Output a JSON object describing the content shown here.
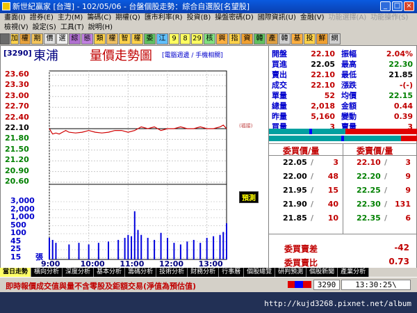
{
  "window": {
    "title": "新世紀贏家 [台灣] - 102/05/06 - 台盤個股走勢：綜合自選股[名望股]"
  },
  "menu": {
    "row1": [
      "畫面(I)",
      "證券(E)",
      "主力(M)",
      "籌碼(C)",
      "期權(Q)",
      "匯市利率(R)",
      "投資(B)",
      "操盤密碼(D)",
      "國際資訊(U)",
      "金融(V)",
      "功能選擇(A)",
      "功能操作(S)"
    ],
    "row2": [
      "檢視(V)",
      "設定(S)",
      "工具(T)",
      "說明(H)"
    ]
  },
  "toolbar": {
    "items": [
      "加",
      "權",
      "期",
      "價",
      "選",
      "綜",
      "態",
      "類",
      "權",
      "智",
      "權",
      "委",
      "江",
      "9",
      "8",
      "29",
      "核",
      "興",
      "指",
      "資",
      "韓",
      "產",
      "韓",
      "基",
      "投",
      "鮮",
      "網"
    ]
  },
  "stock": {
    "code": "[3290]",
    "name": "東浦",
    "chart_title": "量價走勢圖",
    "subtitle": "[電腦週邊 / 手機相關]"
  },
  "chart": {
    "forecast_label": "預測",
    "vol_unit": "張",
    "ref_label": "(福接)"
  },
  "quote": {
    "rows": [
      {
        "l1": "開盤",
        "v1": "22.10",
        "c1": "#c00000",
        "l2": "振幅",
        "v2": "2.04%",
        "c2": "#c00000"
      },
      {
        "l1": "買進",
        "v1": "22.05",
        "c1": "#000000",
        "l2": "最高",
        "v2": "22.30",
        "c2": "#008000"
      },
      {
        "l1": "賣出",
        "v1": "22.10",
        "c1": "#c00000",
        "l2": "最低",
        "v2": "21.85",
        "c2": "#000000"
      },
      {
        "l1": "成交",
        "v1": "22.10",
        "c1": "#c00000",
        "l2": "漲跌",
        "v2": "-(-)",
        "c2": "#c00000"
      },
      {
        "l1": "單量",
        "v1": "52",
        "c1": "#c00000",
        "l2": "均價",
        "v2": "22.15",
        "c2": "#008000"
      },
      {
        "l1": "總量",
        "v1": "2,018",
        "c1": "#c00000",
        "l2": "金額",
        "v2": "0.44",
        "c2": "#c00000"
      },
      {
        "l1": "昨量",
        "v1": "5,160",
        "c1": "#c00000",
        "l2": "變動",
        "v2": "0.39",
        "c2": "#c00000"
      },
      {
        "l1": "買量",
        "v1": "3",
        "c1": "#c00000",
        "l2": "賣量",
        "v2": "3",
        "c2": "#c00000"
      }
    ]
  },
  "orderbook": {
    "bid_header": "委買價/量",
    "ask_header": "委賣價/量",
    "bids": [
      {
        "price": "22.05",
        "vol": "3"
      },
      {
        "price": "22.00",
        "vol": "48"
      },
      {
        "price": "21.95",
        "vol": "15"
      },
      {
        "price": "21.90",
        "vol": "40"
      },
      {
        "price": "21.85",
        "vol": "10"
      }
    ],
    "asks": [
      {
        "price": "22.10",
        "vol": "3"
      },
      {
        "price": "22.20",
        "vol": "9"
      },
      {
        "price": "22.25",
        "vol": "9"
      },
      {
        "price": "22.30",
        "vol": "131"
      },
      {
        "price": "22.35",
        "vol": "6"
      }
    ]
  },
  "summary": {
    "diff_label": "委買賣差",
    "diff_value": "-42",
    "ratio_label": "委買賣比",
    "ratio_value": "0.73"
  },
  "tabs": [
    "當日走勢",
    "橫向分析",
    "深度分析",
    "基本分析",
    "籌碼分析",
    "技術分析",
    "財務分析",
    "行事曆",
    "個股總覽",
    "研判預測",
    "個股新聞",
    "產業分析"
  ],
  "status": {
    "message": "即時報價成交值與量不含零股及鉅額交易(淨值為預估值)",
    "code": "3290",
    "time": "13:30:25\\"
  },
  "watermark": "http://kujd3268.pixnet.net/album",
  "colors": {
    "up": "#c00000",
    "down": "#008000",
    "ref": "#000000",
    "price_line": "#d00000"
  },
  "chart_data": {
    "type": "line",
    "price_axis": {
      "ticks": [
        "23.60",
        "23.30",
        "23.00",
        "22.70",
        "22.40",
        "22.10",
        "21.80",
        "21.50",
        "21.20",
        "20.90",
        "20.60"
      ],
      "range": [
        20.6,
        23.6
      ],
      "reference": 22.1
    },
    "volume_axis": {
      "ticks": [
        "3,000",
        "2,000",
        "1,000",
        "500",
        "100",
        "45",
        "25",
        "15"
      ]
    },
    "x_ticks": [
      "9:00",
      "10:00",
      "11:00",
      "12:00",
      "13:00"
    ],
    "price_series": {
      "x": [
        "9:00",
        "9:05",
        "9:10",
        "9:15",
        "9:20",
        "9:25",
        "9:30",
        "9:40",
        "9:50",
        "10:00",
        "10:10",
        "10:20",
        "10:30",
        "10:40",
        "10:50",
        "11:00",
        "11:10",
        "11:20",
        "11:30",
        "11:40",
        "11:50",
        "12:00",
        "12:10",
        "12:20",
        "12:30",
        "12:40",
        "12:50",
        "13:00",
        "13:10",
        "13:20",
        "13:25",
        "13:30"
      ],
      "y": [
        22.1,
        21.95,
        21.98,
        21.95,
        22.0,
        22.05,
        22.0,
        21.98,
        22.0,
        22.05,
        22.0,
        21.98,
        22.0,
        22.05,
        22.05,
        22.0,
        22.05,
        22.15,
        22.1,
        22.15,
        22.05,
        22.1,
        22.1,
        22.15,
        22.1,
        22.1,
        22.15,
        22.1,
        22.1,
        22.15,
        22.2,
        22.1
      ]
    },
    "volume_series": {
      "x": [
        "9:00",
        "9:05",
        "9:10",
        "9:30",
        "9:45",
        "10:00",
        "10:15",
        "10:30",
        "10:45",
        "10:55",
        "11:00",
        "11:05",
        "11:10",
        "11:15",
        "11:20",
        "11:30",
        "11:40",
        "11:50",
        "12:00",
        "12:10",
        "12:20",
        "12:30",
        "12:40",
        "12:50",
        "13:00",
        "13:10",
        "13:20",
        "13:25",
        "13:30"
      ],
      "y": [
        20,
        15,
        10,
        8,
        10,
        8,
        10,
        12,
        15,
        20,
        30,
        25,
        800,
        60,
        30,
        20,
        15,
        40,
        20,
        10,
        8,
        12,
        15,
        10,
        20,
        25,
        30,
        45,
        150
      ]
    }
  }
}
